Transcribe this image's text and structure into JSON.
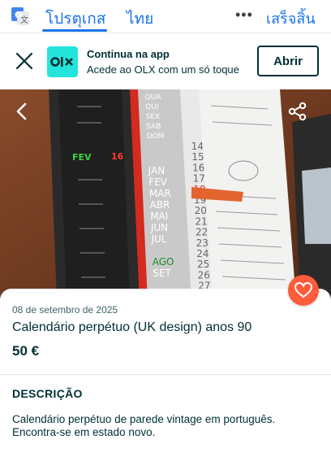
{
  "translate_bar": {
    "active_language": "โปรตุเกส",
    "other_language": "ไทย",
    "more_label": "•••",
    "done_label": "เสร็จสิ้น"
  },
  "app_banner": {
    "logo_text": "OLX",
    "title": "Continua na app",
    "subtitle": "Acede ao OLX com um só toque",
    "open_button": "Abrir"
  },
  "photo": {
    "months": [
      "QUA",
      "QUI",
      "SEX",
      "SAB",
      "DOM",
      "JAN",
      "FEV",
      "MAR",
      "ABR",
      "MAI",
      "JUN",
      "JUL",
      "AGO",
      "SET"
    ],
    "numbers": [
      "14",
      "15",
      "16",
      "17",
      "18",
      "19",
      "20",
      "21",
      "22",
      "23",
      "24",
      "25",
      "26",
      "27"
    ],
    "left_strip_month": "FEV",
    "left_strip_day": "16"
  },
  "listing": {
    "date": "08 de setembro de 2025",
    "title": "Calendário perpétuo (UK design) anos 90",
    "price": "50 €"
  },
  "description": {
    "heading": "DESCRIÇÃO",
    "lines": [
      "Calendário perpétuo de parede vintage em português.",
      "Encontra-se em estado novo."
    ]
  },
  "colors": {
    "brand_teal": "#23e5db",
    "brand_dark": "#002f34",
    "favorite": "#ff5c3b",
    "translate_blue": "#1a73e8"
  }
}
